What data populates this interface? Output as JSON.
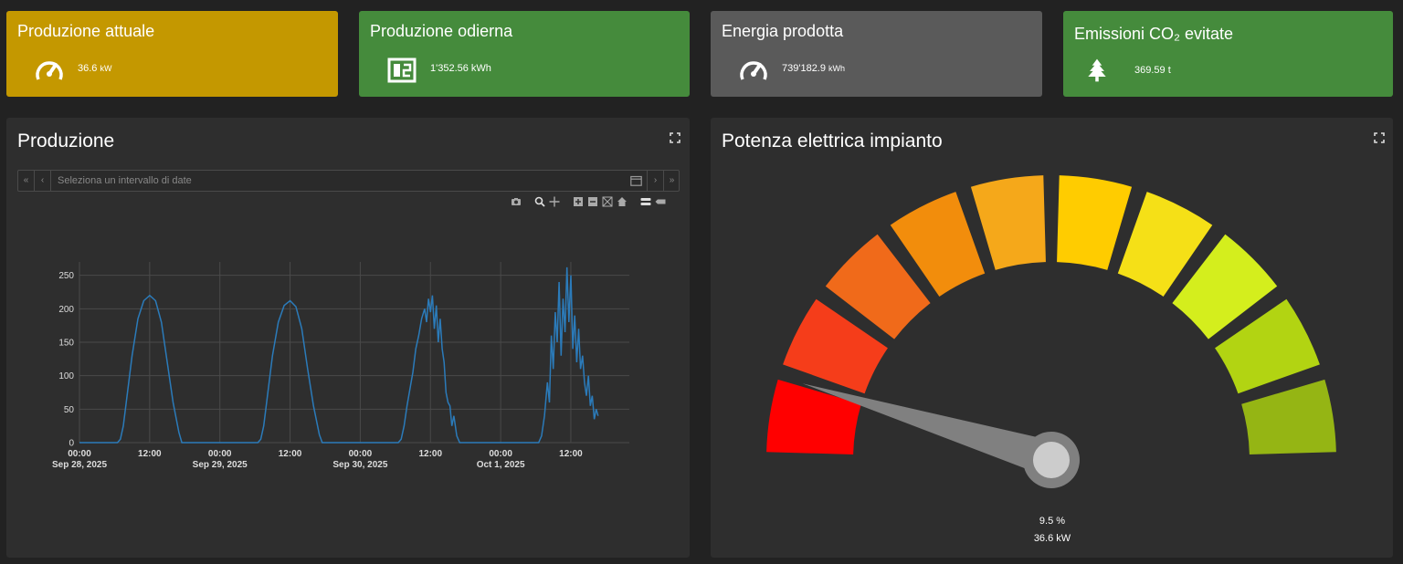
{
  "tiles": [
    {
      "title": "Produzione attuale",
      "value": "36.6",
      "unit": "kW",
      "icon": "speedometer-icon",
      "color": "#c49800"
    },
    {
      "title": "Produzione odierna",
      "value": "1'352.56 kWh",
      "unit": "",
      "icon": "calendar-day-icon",
      "color": "#458b3c"
    },
    {
      "title": "Energia prodotta",
      "value": "739'182.9",
      "unit": "kWh",
      "icon": "speedometer-icon",
      "color": "#5a5a5a"
    },
    {
      "title": "Emissioni CO₂ evitate",
      "value": "369.59 t",
      "unit": "",
      "icon": "tree-icon",
      "color": "#458b3c"
    }
  ],
  "production_panel": {
    "title": "Produzione",
    "date_placeholder": "Seleziona un intervallo di date",
    "nav": {
      "first": "«",
      "prev": "‹",
      "next": "›",
      "last": "»"
    }
  },
  "chart_data": {
    "type": "line",
    "x_range": [
      "2025-09-28 00:00",
      "2025-10-01 22:00"
    ],
    "y_range": [
      0,
      270
    ],
    "y_ticks": [
      "0",
      "50",
      "100",
      "150",
      "200",
      "250"
    ],
    "x_ticks": [
      {
        "time": "00:00",
        "date": "Sep 28, 2025"
      },
      {
        "time": "12:00",
        "date": ""
      },
      {
        "time": "00:00",
        "date": "Sep 29, 2025"
      },
      {
        "time": "12:00",
        "date": ""
      },
      {
        "time": "00:00",
        "date": "Sep 30, 2025"
      },
      {
        "time": "12:00",
        "date": ""
      },
      {
        "time": "00:00",
        "date": "Oct 1, 2025"
      },
      {
        "time": "12:00",
        "date": ""
      }
    ],
    "grid": true,
    "series": [
      {
        "color": "#2b7bba",
        "points": [
          [
            "2025-09-28 00:00",
            0
          ],
          [
            "2025-09-28 06:30",
            0
          ],
          [
            "2025-09-28 07:00",
            5
          ],
          [
            "2025-09-28 07:30",
            25
          ],
          [
            "2025-09-28 08:00",
            60
          ],
          [
            "2025-09-28 09:00",
            130
          ],
          [
            "2025-09-28 10:00",
            185
          ],
          [
            "2025-09-28 11:00",
            212
          ],
          [
            "2025-09-28 12:00",
            220
          ],
          [
            "2025-09-28 13:00",
            212
          ],
          [
            "2025-09-28 14:00",
            180
          ],
          [
            "2025-09-28 15:00",
            120
          ],
          [
            "2025-09-28 16:00",
            60
          ],
          [
            "2025-09-28 17:00",
            15
          ],
          [
            "2025-09-28 17:30",
            0
          ],
          [
            "2025-09-29 06:30",
            0
          ],
          [
            "2025-09-29 07:00",
            5
          ],
          [
            "2025-09-29 07:30",
            25
          ],
          [
            "2025-09-29 08:00",
            60
          ],
          [
            "2025-09-29 09:00",
            130
          ],
          [
            "2025-09-29 10:00",
            180
          ],
          [
            "2025-09-29 11:00",
            205
          ],
          [
            "2025-09-29 12:00",
            212
          ],
          [
            "2025-09-29 13:00",
            203
          ],
          [
            "2025-09-29 14:00",
            170
          ],
          [
            "2025-09-29 15:00",
            110
          ],
          [
            "2025-09-29 16:00",
            55
          ],
          [
            "2025-09-29 17:00",
            12
          ],
          [
            "2025-09-29 17:30",
            0
          ],
          [
            "2025-09-30 06:30",
            0
          ],
          [
            "2025-09-30 07:00",
            5
          ],
          [
            "2025-09-30 07:30",
            25
          ],
          [
            "2025-09-30 08:00",
            55
          ],
          [
            "2025-09-30 08:30",
            80
          ],
          [
            "2025-09-30 09:00",
            105
          ],
          [
            "2025-09-30 09:30",
            140
          ],
          [
            "2025-09-30 10:00",
            160
          ],
          [
            "2025-09-30 10:30",
            185
          ],
          [
            "2025-09-30 11:00",
            200
          ],
          [
            "2025-09-30 11:20",
            180
          ],
          [
            "2025-09-30 11:40",
            215
          ],
          [
            "2025-09-30 12:00",
            195
          ],
          [
            "2025-09-30 12:20",
            220
          ],
          [
            "2025-09-30 12:40",
            170
          ],
          [
            "2025-09-30 13:00",
            205
          ],
          [
            "2025-09-30 13:20",
            150
          ],
          [
            "2025-09-30 13:40",
            185
          ],
          [
            "2025-09-30 14:00",
            140
          ],
          [
            "2025-09-30 14:20",
            120
          ],
          [
            "2025-09-30 14:40",
            75
          ],
          [
            "2025-09-30 15:00",
            60
          ],
          [
            "2025-09-30 15:20",
            55
          ],
          [
            "2025-09-30 15:40",
            25
          ],
          [
            "2025-09-30 16:00",
            40
          ],
          [
            "2025-09-30 16:30",
            10
          ],
          [
            "2025-09-30 17:00",
            0
          ],
          [
            "2025-10-01 06:30",
            0
          ],
          [
            "2025-10-01 07:00",
            10
          ],
          [
            "2025-10-01 07:30",
            40
          ],
          [
            "2025-10-01 08:00",
            90
          ],
          [
            "2025-10-01 08:20",
            60
          ],
          [
            "2025-10-01 08:40",
            160
          ],
          [
            "2025-10-01 09:00",
            110
          ],
          [
            "2025-10-01 09:20",
            195
          ],
          [
            "2025-10-01 09:40",
            150
          ],
          [
            "2025-10-01 10:00",
            240
          ],
          [
            "2025-10-01 10:20",
            130
          ],
          [
            "2025-10-01 10:40",
            215
          ],
          [
            "2025-10-01 11:00",
            165
          ],
          [
            "2025-10-01 11:20",
            262
          ],
          [
            "2025-10-01 11:40",
            180
          ],
          [
            "2025-10-01 12:00",
            250
          ],
          [
            "2025-10-01 12:20",
            140
          ],
          [
            "2025-10-01 12:40",
            190
          ],
          [
            "2025-10-01 13:00",
            120
          ],
          [
            "2025-10-01 13:20",
            170
          ],
          [
            "2025-10-01 13:40",
            110
          ],
          [
            "2025-10-01 14:00",
            130
          ],
          [
            "2025-10-01 14:20",
            90
          ],
          [
            "2025-10-01 14:40",
            70
          ],
          [
            "2025-10-01 15:00",
            100
          ],
          [
            "2025-10-01 15:20",
            55
          ],
          [
            "2025-10-01 15:40",
            70
          ],
          [
            "2025-10-01 16:00",
            35
          ],
          [
            "2025-10-01 16:20",
            50
          ],
          [
            "2025-10-01 16:40",
            40
          ]
        ]
      }
    ]
  },
  "gauge_panel": {
    "title": "Potenza elettrica impianto",
    "percent_label": "9.5 %",
    "power_label": "36.6 kW",
    "percent_value": 9.5,
    "segment_colors": [
      "#ff0000",
      "#f53d1a",
      "#f06a1a",
      "#f28d0c",
      "#f5a81a",
      "#ffcc00",
      "#f5e017",
      "#d4ee1d",
      "#b2d412",
      "#95b514"
    ]
  },
  "colors": {
    "background": "#222222",
    "panel": "#2e2e2e",
    "gauge_needle": "#808080",
    "gauge_hub": "#cccccc"
  }
}
